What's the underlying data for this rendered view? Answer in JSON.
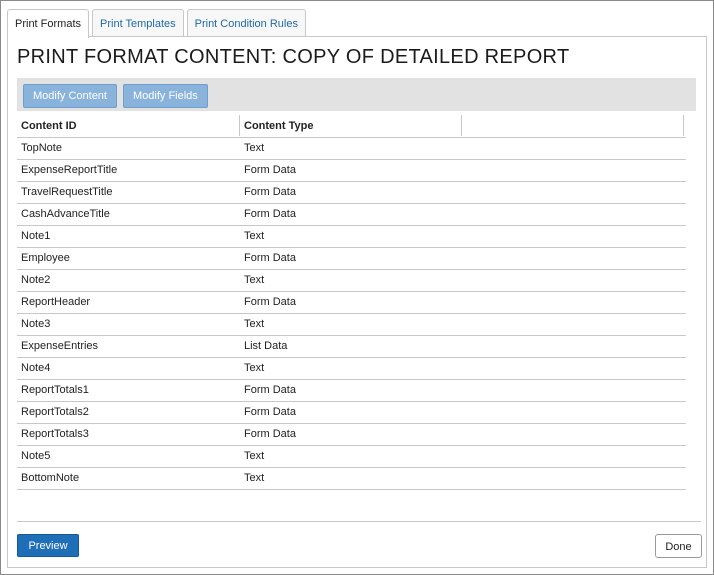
{
  "tabs": [
    {
      "label": "Print Formats",
      "active": true
    },
    {
      "label": "Print Templates",
      "active": false
    },
    {
      "label": "Print Condition Rules",
      "active": false
    }
  ],
  "page": {
    "title": "PRINT FORMAT CONTENT: COPY OF DETAILED REPORT"
  },
  "toolbar": {
    "modify_content_label": "Modify Content",
    "modify_fields_label": "Modify Fields"
  },
  "table": {
    "columns": [
      "Content ID",
      "Content Type",
      ""
    ],
    "rows": [
      {
        "id": "TopNote",
        "type": "Text"
      },
      {
        "id": "ExpenseReportTitle",
        "type": "Form Data"
      },
      {
        "id": "TravelRequestTitle",
        "type": "Form Data"
      },
      {
        "id": "CashAdvanceTitle",
        "type": "Form Data"
      },
      {
        "id": "Note1",
        "type": "Text"
      },
      {
        "id": "Employee",
        "type": "Form Data"
      },
      {
        "id": "Note2",
        "type": "Text"
      },
      {
        "id": "ReportHeader",
        "type": "Form Data"
      },
      {
        "id": "Note3",
        "type": "Text"
      },
      {
        "id": "ExpenseEntries",
        "type": "List Data"
      },
      {
        "id": "Note4",
        "type": "Text"
      },
      {
        "id": "ReportTotals1",
        "type": "Form Data"
      },
      {
        "id": "ReportTotals2",
        "type": "Form Data"
      },
      {
        "id": "ReportTotals3",
        "type": "Form Data"
      },
      {
        "id": "Note5",
        "type": "Text"
      },
      {
        "id": "BottomNote",
        "type": "Text"
      }
    ]
  },
  "footer": {
    "preview_label": "Preview",
    "done_label": "Done"
  },
  "colors": {
    "accent": "#1e6fb8",
    "disabled_button": "#8ab3db",
    "toolbar_bg": "#e2e2e2",
    "link": "#1f6aa5"
  }
}
